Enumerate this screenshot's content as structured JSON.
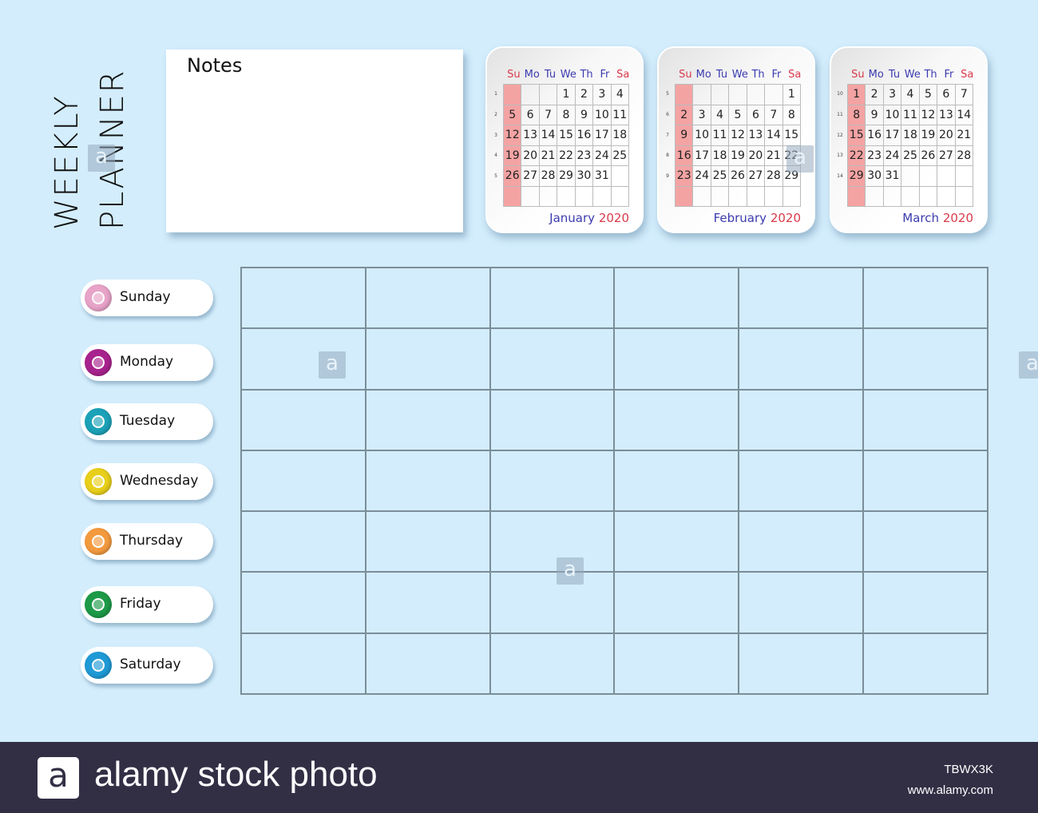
{
  "title": {
    "line1": "WEEKLY",
    "line2": "PLANNER"
  },
  "notes": {
    "title": "Notes"
  },
  "weekday_headers": [
    "Su",
    "Mo",
    "Tu",
    "We",
    "Th",
    "Fr",
    "Sa"
  ],
  "months": [
    {
      "name": "January",
      "year": "2020",
      "week_numbers": [
        "1",
        "2",
        "3",
        "4",
        "5",
        ""
      ],
      "weeks": [
        [
          "",
          "",
          "",
          "1",
          "2",
          "3",
          "4"
        ],
        [
          "5",
          "6",
          "7",
          "8",
          "9",
          "10",
          "11"
        ],
        [
          "12",
          "13",
          "14",
          "15",
          "16",
          "17",
          "18"
        ],
        [
          "19",
          "20",
          "21",
          "22",
          "23",
          "24",
          "25"
        ],
        [
          "26",
          "27",
          "28",
          "29",
          "30",
          "31",
          ""
        ],
        [
          "",
          "",
          "",
          "",
          "",
          "",
          ""
        ]
      ]
    },
    {
      "name": "February",
      "year": "2020",
      "week_numbers": [
        "5",
        "6",
        "7",
        "8",
        "9",
        ""
      ],
      "weeks": [
        [
          "",
          "",
          "",
          "",
          "",
          "",
          "1"
        ],
        [
          "2",
          "3",
          "4",
          "5",
          "6",
          "7",
          "8"
        ],
        [
          "9",
          "10",
          "11",
          "12",
          "13",
          "14",
          "15"
        ],
        [
          "16",
          "17",
          "18",
          "19",
          "20",
          "21",
          "22"
        ],
        [
          "23",
          "24",
          "25",
          "26",
          "27",
          "28",
          "29"
        ],
        [
          "",
          "",
          "",
          "",
          "",
          "",
          ""
        ]
      ]
    },
    {
      "name": "March",
      "year": "2020",
      "week_numbers": [
        "10",
        "11",
        "12",
        "13",
        "14",
        ""
      ],
      "weeks": [
        [
          "1",
          "2",
          "3",
          "4",
          "5",
          "6",
          "7"
        ],
        [
          "8",
          "9",
          "10",
          "11",
          "12",
          "13",
          "14"
        ],
        [
          "15",
          "16",
          "17",
          "18",
          "19",
          "20",
          "21"
        ],
        [
          "22",
          "23",
          "24",
          "25",
          "26",
          "27",
          "28"
        ],
        [
          "29",
          "30",
          "31",
          "",
          "",
          "",
          ""
        ],
        [
          "",
          "",
          "",
          "",
          "",
          "",
          ""
        ]
      ]
    }
  ],
  "days": [
    {
      "label": "Sunday",
      "color": "#e8a3c8"
    },
    {
      "label": "Monday",
      "color": "#a8238d"
    },
    {
      "label": "Tuesday",
      "color": "#1ca2b8"
    },
    {
      "label": "Wednesday",
      "color": "#e8cf1a"
    },
    {
      "label": "Thursday",
      "color": "#f39a3e"
    },
    {
      "label": "Friday",
      "color": "#1d9a48"
    },
    {
      "label": "Saturday",
      "color": "#1f9ad6"
    }
  ],
  "schedule": {
    "rows": 7,
    "columns": 6
  },
  "colors": {
    "background": "#d3edfc",
    "weekend_header": "#d93a4a",
    "weekday_header": "#3b3bb0",
    "sunday_column": "#f4a3a3",
    "grid_line": "#7a8e99",
    "footer": "#322f45"
  },
  "watermark": {
    "logo_glyph": "a",
    "brand": "alamy stock photo",
    "image_id": "TBWX3K",
    "url": "www.alamy.com"
  }
}
